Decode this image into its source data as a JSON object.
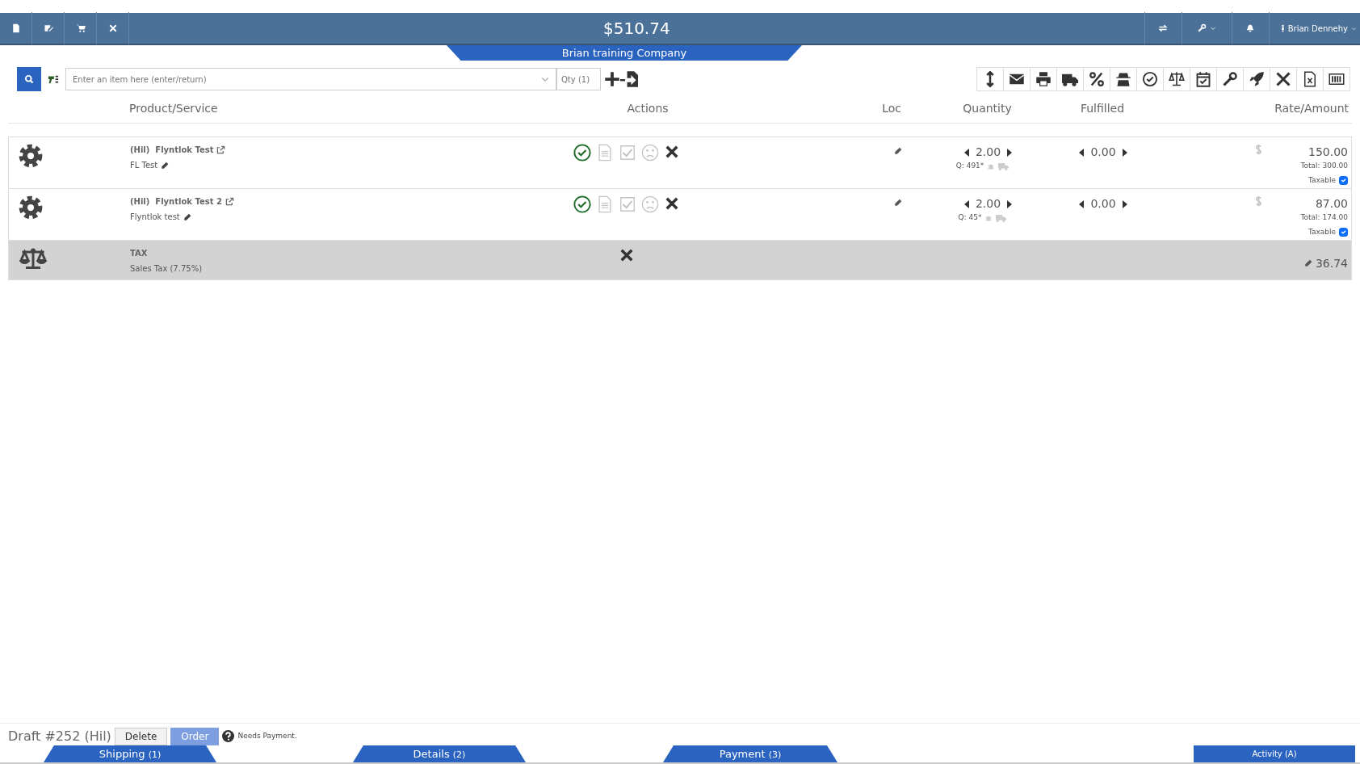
{
  "topbar": {
    "total": "$510.74",
    "user": "Brian Dennehy",
    "company": "Brian training Company"
  },
  "search": {
    "placeholder": "Enter an item here (enter/return)",
    "qty_placeholder": "Qty (1)"
  },
  "columns": [
    "Product/Service",
    "Actions",
    "Loc",
    "Quantity",
    "Fulfilled",
    "Rate/Amount"
  ],
  "rows": [
    {
      "kind": "item",
      "prefix": "(Hil)",
      "name": "Flyntlok Test",
      "description": "FL Test",
      "approved": true,
      "quantity": "2.00",
      "stock": "Q: 491*",
      "fulfilled": "0.00",
      "rate": "150.00",
      "total": "Total: 300.00",
      "taxable_label": "Taxable",
      "taxable": true
    },
    {
      "kind": "item",
      "prefix": "(Hil)",
      "name": "Flyntlok Test 2",
      "description": "Flyntlok test",
      "approved": true,
      "quantity": "2.00",
      "stock": "Q: 45*",
      "fulfilled": "0.00",
      "rate": "87.00",
      "total": "Total: 174.00",
      "taxable_label": "Taxable",
      "taxable": true
    },
    {
      "kind": "tax",
      "title": "TAX",
      "description": "Sales Tax (7.75%)",
      "amount": "36.74"
    }
  ],
  "footer": {
    "title": "Draft #252 (Hil)",
    "buttons": [
      "Delete",
      "Order"
    ],
    "status": "Needs Payment."
  },
  "tabs": [
    {
      "label": "Shipping",
      "count": "(1)"
    },
    {
      "label": "Details",
      "count": "(2)"
    },
    {
      "label": "Payment",
      "count": "(3)"
    },
    {
      "label": "Activity",
      "count": "(A)"
    }
  ]
}
